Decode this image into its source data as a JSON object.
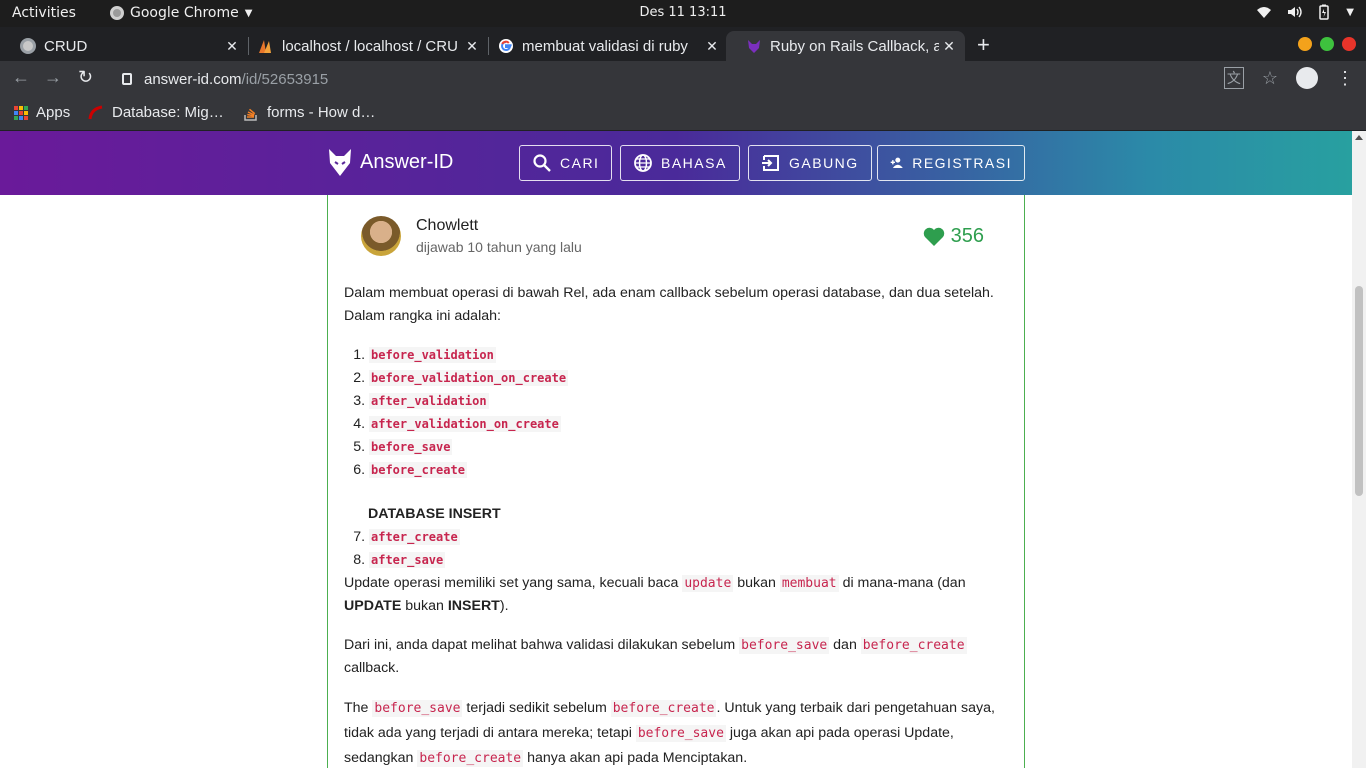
{
  "system": {
    "activities": "Activities",
    "app_name": "Google Chrome",
    "clock": "Des 11  13:11"
  },
  "tabs": [
    {
      "title": "CRUD",
      "active": false
    },
    {
      "title": "localhost / localhost / CRU",
      "active": false
    },
    {
      "title": "membuat validasi di ruby",
      "active": false
    },
    {
      "title": "Ruby on Rails Callback, ap",
      "active": true
    }
  ],
  "toolbar": {
    "url_host": "answer-id.com",
    "url_path": "/id/52653915"
  },
  "bookmarks": [
    {
      "label": "Apps"
    },
    {
      "label": "Database: Mig…"
    },
    {
      "label": "forms - How d…"
    }
  ],
  "site": {
    "logo_text": "Answer-ID",
    "nav": [
      {
        "label": "CARI",
        "icon": "search-icon"
      },
      {
        "label": "BAHASA",
        "icon": "globe-icon"
      },
      {
        "label": "GABUNG",
        "icon": "login-icon"
      },
      {
        "label": "REGISTRASI",
        "icon": "add-user-icon"
      }
    ]
  },
  "answer": {
    "author": "Chowlett",
    "meta": "dijawab 10 tahun yang lalu",
    "votes": "356",
    "intro_1": "Dalam membuat operasi di bawah Rel, ada enam callback sebelum operasi database, dan dua setelah.",
    "intro_2": "Dalam rangka ini adalah:",
    "list_before": [
      "before_validation",
      "before_validation_on_create",
      "after_validation",
      "after_validation_on_create",
      "before_save",
      "before_create"
    ],
    "db_insert": "DATABASE INSERT",
    "list_after": [
      "after_create",
      "after_save"
    ],
    "p2": {
      "a": "Update operasi memiliki set yang sama, kecuali baca ",
      "code1": "update",
      "b": " bukan ",
      "code2": "membuat",
      "c": " di mana-mana (dan",
      "bold1": "UPDATE",
      "d": " bukan ",
      "bold2": "INSERT",
      "e": ")."
    },
    "p3": {
      "a": "Dari ini, anda dapat melihat bahwa validasi dilakukan sebelum ",
      "code1": "before_save",
      "b": " dan ",
      "code2": "before_create",
      "c": "callback."
    },
    "p4": {
      "a": "The ",
      "code1": "before_save",
      "b": " terjadi sedikit sebelum ",
      "code2": "before_create",
      "c": ". Untuk yang terbaik dari pengetahuan saya,",
      "d": "tidak ada yang terjadi di antara mereka; tetapi ",
      "code3": "before_save",
      "e": " juga akan api pada operasi Update,",
      "f": "sedangkan ",
      "code4": "before_create",
      "g": " hanya akan api pada Menciptakan."
    }
  },
  "colors": {
    "accent_green": "#2e9e4e",
    "code_red": "#c7254e",
    "header_start": "#6a1a9a",
    "header_end": "#28a0a0"
  }
}
